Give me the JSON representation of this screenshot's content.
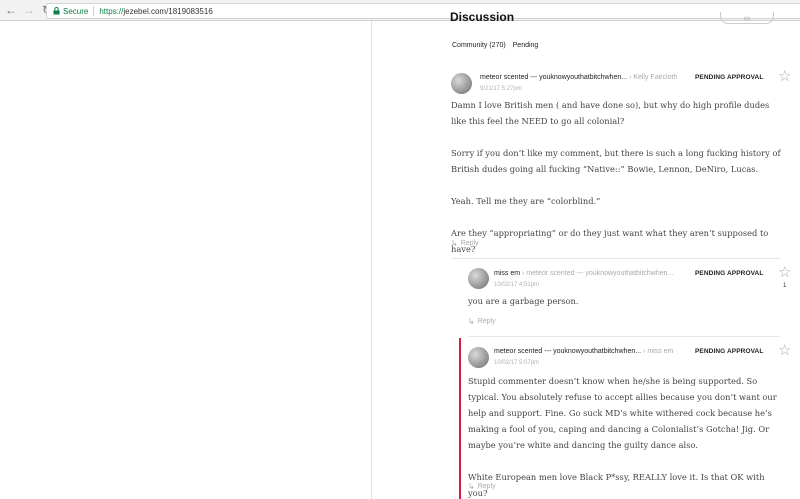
{
  "browser": {
    "secure_label": "Secure",
    "url_protocol": "https://",
    "url_host": "jezebel.com/1819083516"
  },
  "discussion": {
    "title": "Discussion",
    "tabs": [
      "Community (270)",
      "Pending"
    ]
  },
  "comments": [
    {
      "author": "meteor scented --- youknowyouthatbitchwhen...",
      "reply_to": "Kelly Faircloth",
      "timestamp": "9/21/17 5:27pm",
      "status": "PENDING APPROVAL",
      "paragraphs": [
        "Damn I love British men ( and have done so), but why do high profile dudes like this feel the NEED to go all colonial?",
        "Sorry if you don’t like my comment, but there is such a long fucking history of British dudes going all fucking “Native::” Bowie, Lennon, DeNiro, Lucas.",
        "Yeah. Tell me they are “colorblind.”",
        "Are they “appropriating” or do they just want what they aren’t supposed to have?"
      ],
      "reply_label": "Reply"
    },
    {
      "author": "miss em",
      "reply_to": "meteor scented --- youknowyouthatbitchwhen...",
      "timestamp": "10/02/17 4:51pm",
      "status": "PENDING APPROVAL",
      "star_count": "1",
      "paragraphs": [
        "you are a garbage person."
      ],
      "reply_label": "Reply"
    },
    {
      "author": "meteor scented --- youknowyouthatbitchwhen...",
      "reply_to": "miss em",
      "timestamp": "10/02/17 5:07pm",
      "status": "PENDING APPROVAL",
      "paragraphs": [
        "Stupid commenter doesn’t know when he/she is being supported. So typical. You absolutely refuse to accept allies because you don’t want our help and support. Fine. Go suck MD’s white withered cock because he’s making a fool of you, caping and dancing a Colonialist’s Gotcha! Jig. Or maybe you’re white and dancing the guilty dance also.",
        "White European men love Black P*ssy, REALLY love it. Is that OK with you?"
      ],
      "reply_label": "Reply"
    }
  ],
  "colors": {
    "accent_red": "#d81c3a",
    "secure_green": "#0b8043"
  }
}
